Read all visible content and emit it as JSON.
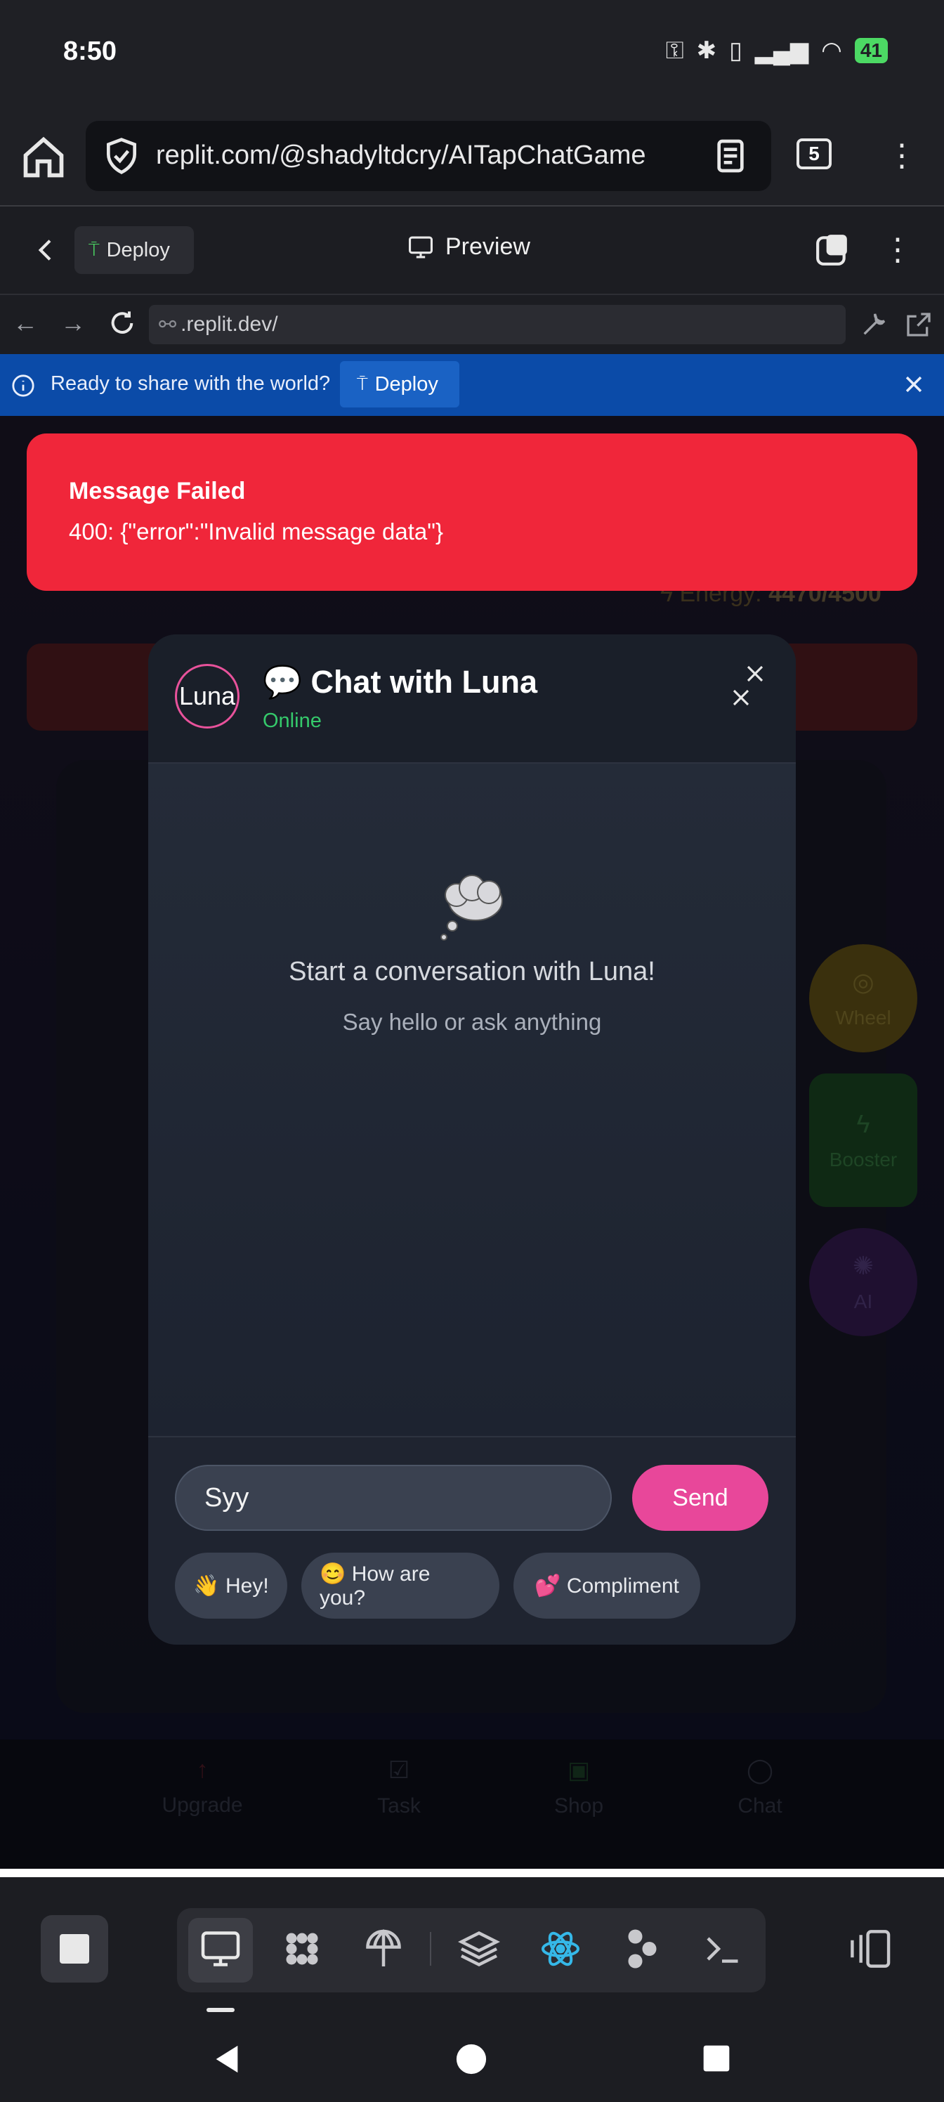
{
  "status_bar": {
    "time": "8:50",
    "battery": "41"
  },
  "browser": {
    "url": "replit.com/@shadyltdcry/AITapChatGame",
    "tab_count": "5"
  },
  "replit_header": {
    "deploy_label": "Deploy",
    "preview_label": "Preview"
  },
  "address_bar": {
    "url": ".replit.dev/"
  },
  "banner": {
    "text": "Ready to share with the world?",
    "deploy_label": "Deploy"
  },
  "app": {
    "energy_label": "Energy:",
    "energy_value": "4470/4500",
    "side_buttons": {
      "wheel": "Wheel",
      "booster": "Booster",
      "ai": "AI"
    },
    "bottom_nav": {
      "upgrade": "Upgrade",
      "task": "Task",
      "shop": "Shop",
      "chat": "Chat"
    }
  },
  "toast": {
    "title": "Message Failed",
    "message": "400: {\"error\":\"Invalid message data\"}",
    "color": "#f0263a"
  },
  "chat_modal": {
    "avatar_text": "Luna",
    "title": "💬 Chat with Luna",
    "status": "Online",
    "empty_title": "Start a conversation with Luna!",
    "empty_subtitle": "Say hello or ask anything",
    "input_value": "Syy",
    "send_label": "Send",
    "quick_replies": [
      "👋 Hey!",
      "😊 How are you?",
      "💕 Compliment"
    ],
    "accent": "#e8479a"
  },
  "icons": {
    "home": "home-icon",
    "shield": "shield-check-icon",
    "reader": "reader-icon",
    "tools": [
      "monitor-icon",
      "apps-icon",
      "deploy-icon",
      "layers-icon",
      "react-icon",
      "agent-icon",
      "terminal-icon"
    ]
  }
}
